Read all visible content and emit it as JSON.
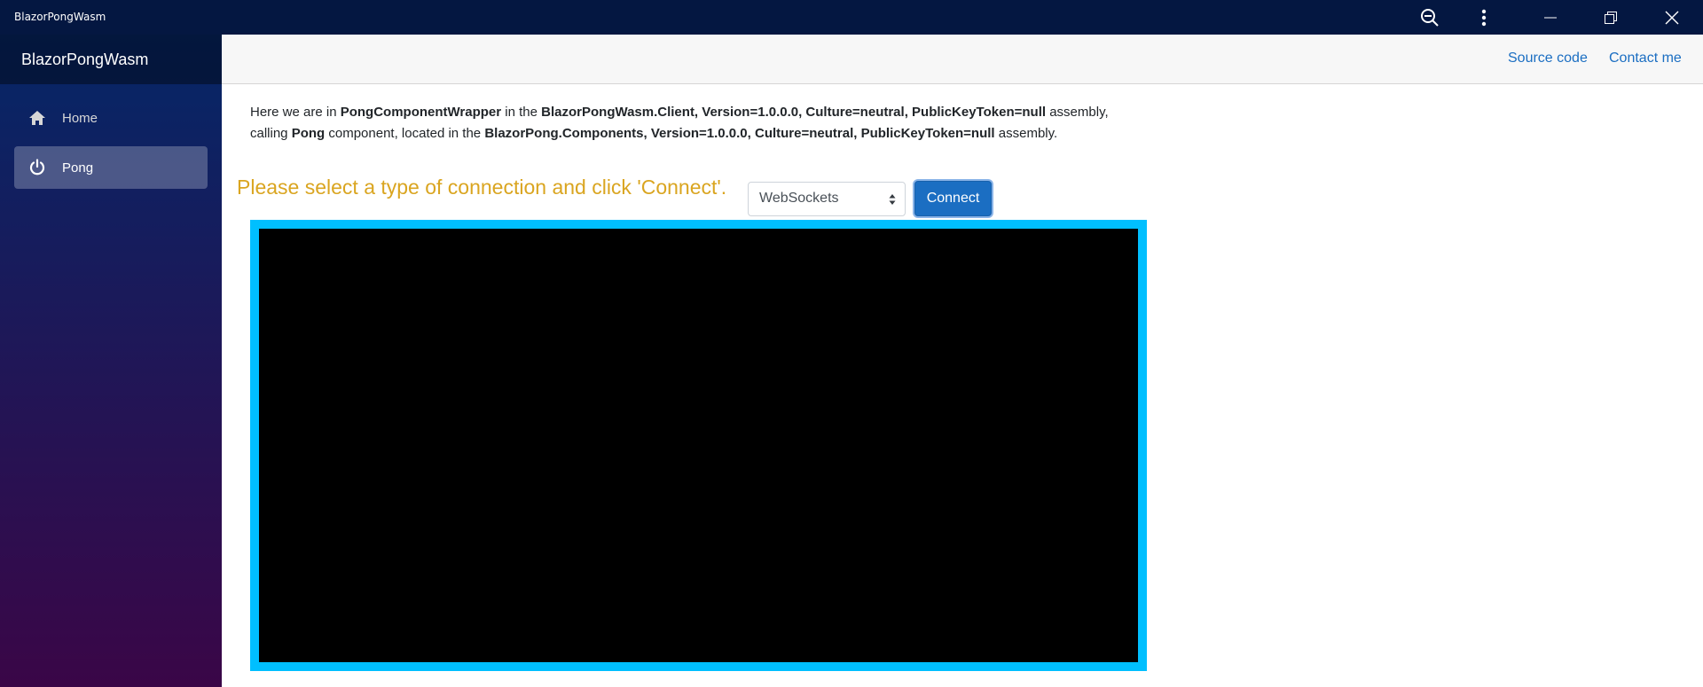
{
  "window": {
    "title": "BlazorPongWasm",
    "controls": [
      "zoom-out-icon",
      "more-icon",
      "minimize-icon",
      "restore-icon",
      "close-icon"
    ]
  },
  "sidebar": {
    "brand": "BlazorPongWasm",
    "items": [
      {
        "label": "Home",
        "icon": "home-icon",
        "active": false
      },
      {
        "label": "Pong",
        "icon": "power-icon",
        "active": true
      }
    ]
  },
  "topbar": {
    "links": [
      "Source code",
      "Contact me"
    ]
  },
  "intro": {
    "line1": {
      "t1": "Here we are in ",
      "b1": "PongComponentWrapper",
      "t2": " in the ",
      "b2": "BlazorPongWasm.Client, Version=1.0.0.0, Culture=neutral, PublicKeyToken=null",
      "t3": " assembly,"
    },
    "line2": {
      "t1": "calling ",
      "b1": "Pong",
      "t2": " component, located in the ",
      "b2": "BlazorPong.Components, Version=1.0.0.0, Culture=neutral, PublicKeyToken=null",
      "t3": " assembly."
    }
  },
  "connection": {
    "prompt": "Please select a type of connection and click 'Connect'.",
    "selected": "WebSockets",
    "button": "Connect"
  },
  "colors": {
    "titlebar": "#041741",
    "accent": "#1b6ec2",
    "prompt": "#daa520",
    "frame": "#00bfff",
    "canvas": "#000000"
  }
}
